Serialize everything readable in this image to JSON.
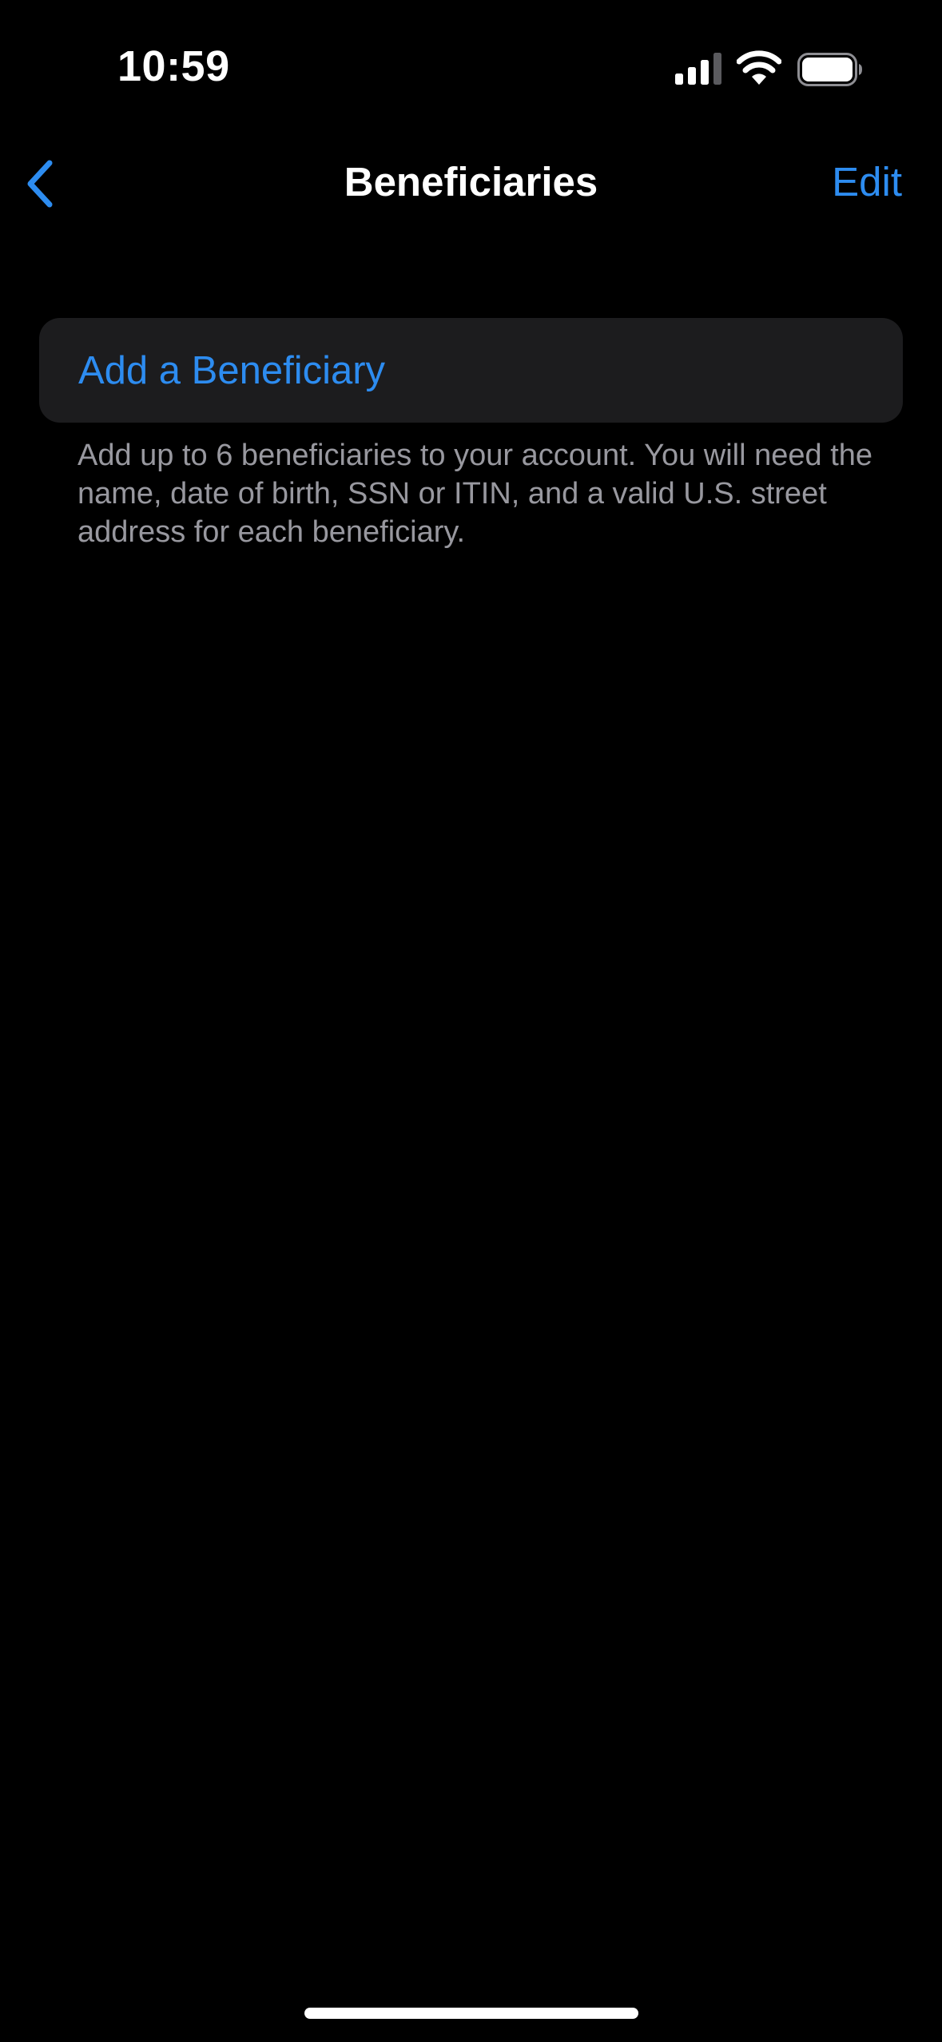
{
  "status_bar": {
    "time": "10:59",
    "icons": [
      "signal-icon",
      "wifi-icon",
      "battery-icon"
    ]
  },
  "nav": {
    "back_icon": "chevron-left-icon",
    "title": "Beneficiaries",
    "edit_label": "Edit"
  },
  "card": {
    "label": "Add a Beneficiary"
  },
  "footnote": {
    "text": "Add up to 6 beneficiaries to your account. You will need the name, date of birth, SSN or ITIN, and a valid U.S. street address for each beneficiary."
  },
  "colors": {
    "accent": "#2d8cf0",
    "background": "#000000",
    "card_background": "#1c1c1e",
    "secondary_text": "#98989f"
  }
}
